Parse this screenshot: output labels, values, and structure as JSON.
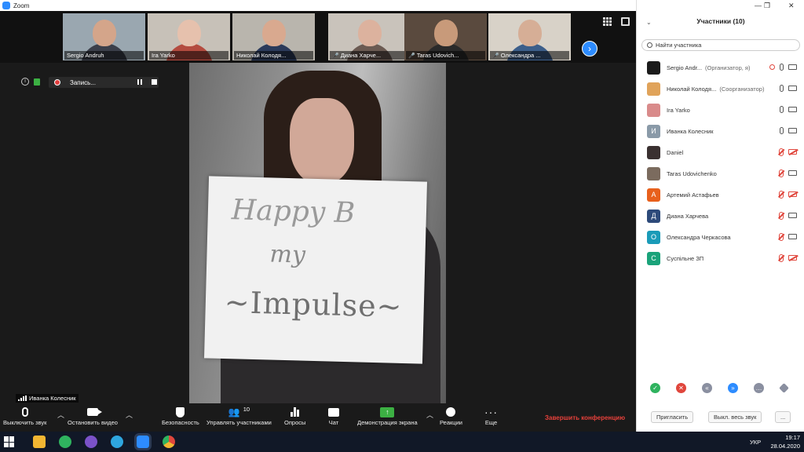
{
  "window": {
    "title": "Zoom"
  },
  "thumbnails": [
    {
      "name": "Sergio Andruh",
      "muted": false,
      "bg": "#9aa7b0",
      "face": "#d4a58a",
      "body": "#3b3f4a"
    },
    {
      "name": "Ira Yarko",
      "muted": false,
      "bg": "#c7c1b8",
      "face": "#e6c1ad",
      "body": "#b44b3f"
    },
    {
      "name": "Николай Колодя...",
      "muted": false,
      "bg": "#b9b5ad",
      "face": "#d9a98f",
      "body": "#2b3a5a"
    },
    {
      "name": "Диана Харче...",
      "muted": true,
      "bg": "#c9c3bb",
      "face": "#dcb29e",
      "body": "#6b5a52"
    },
    {
      "name": "Taras Udovich...",
      "muted": true,
      "bg": "#5a4a3e",
      "face": "#c89a7a",
      "body": "#2a2a2a"
    },
    {
      "name": "Олександра ...",
      "muted": true,
      "bg": "#d8d2c8",
      "face": "#d6ae96",
      "body": "#3c5e8a"
    }
  ],
  "recording": {
    "label": "Запись..."
  },
  "main_video": {
    "sign_line1": "Happy B",
    "sign_line2": "my",
    "sign_line3": "~Impulse~",
    "speaker_name": "Иванка Колесник"
  },
  "toolbar": {
    "mute_label": "Выключить звук",
    "video_label": "Остановить видео",
    "security_label": "Безопасность",
    "participants_label": "Управлять участниками",
    "participants_count": "10",
    "polls_label": "Опросы",
    "chat_label": "Чат",
    "share_label": "Демонстрация экрана",
    "reactions_label": "Реакции",
    "more_label": "Еще",
    "end_label": "Завершить конференцию"
  },
  "panel": {
    "title": "Участники (10)",
    "search_placeholder": "Найти участника",
    "participants": [
      {
        "name": "Sergio Andr...",
        "role": "(Организатор, я)",
        "avatar_letter": "",
        "avatar_color": "#1b1b1b",
        "recording": true,
        "mic": "on",
        "cam": "on"
      },
      {
        "name": "Николай Колодя...",
        "role": "(Соорганизатор)",
        "avatar_letter": "",
        "avatar_color": "#e0a35a",
        "recording": false,
        "mic": "on",
        "cam": "on"
      },
      {
        "name": "Ira Yarko",
        "role": "",
        "avatar_letter": "",
        "avatar_color": "#d98b8b",
        "recording": false,
        "mic": "on",
        "cam": "on"
      },
      {
        "name": "Иванка Колесник",
        "role": "",
        "avatar_letter": "И",
        "avatar_color": "#8a9aa8",
        "recording": false,
        "mic": "on",
        "cam": "on"
      },
      {
        "name": "Daniel",
        "role": "",
        "avatar_letter": "",
        "avatar_color": "#3a3030",
        "recording": false,
        "mic": "off",
        "cam": "off"
      },
      {
        "name": "Taras Udovichenko",
        "role": "",
        "avatar_letter": "",
        "avatar_color": "#7b6b5e",
        "recording": false,
        "mic": "off",
        "cam": "on"
      },
      {
        "name": "Артемий Астафьев",
        "role": "",
        "avatar_letter": "А",
        "avatar_color": "#e8601c",
        "recording": false,
        "mic": "off",
        "cam": "off"
      },
      {
        "name": "Диана Харчева",
        "role": "",
        "avatar_letter": "Д",
        "avatar_color": "#2d4a7a",
        "recording": false,
        "mic": "off",
        "cam": "on"
      },
      {
        "name": "Олександра Черкасова",
        "role": "",
        "avatar_letter": "О",
        "avatar_color": "#1a9bb8",
        "recording": false,
        "mic": "off",
        "cam": "on"
      },
      {
        "name": "Суспільне ЗП",
        "role": "",
        "avatar_letter": "С",
        "avatar_color": "#1aa37a",
        "recording": false,
        "mic": "off",
        "cam": "off"
      }
    ],
    "invite_label": "Пригласить",
    "mute_all_label": "Выкл. весь звук",
    "more_label": "..."
  },
  "taskbar": {
    "language": "УКР",
    "time": "19:17",
    "date": "28.04.2020"
  }
}
